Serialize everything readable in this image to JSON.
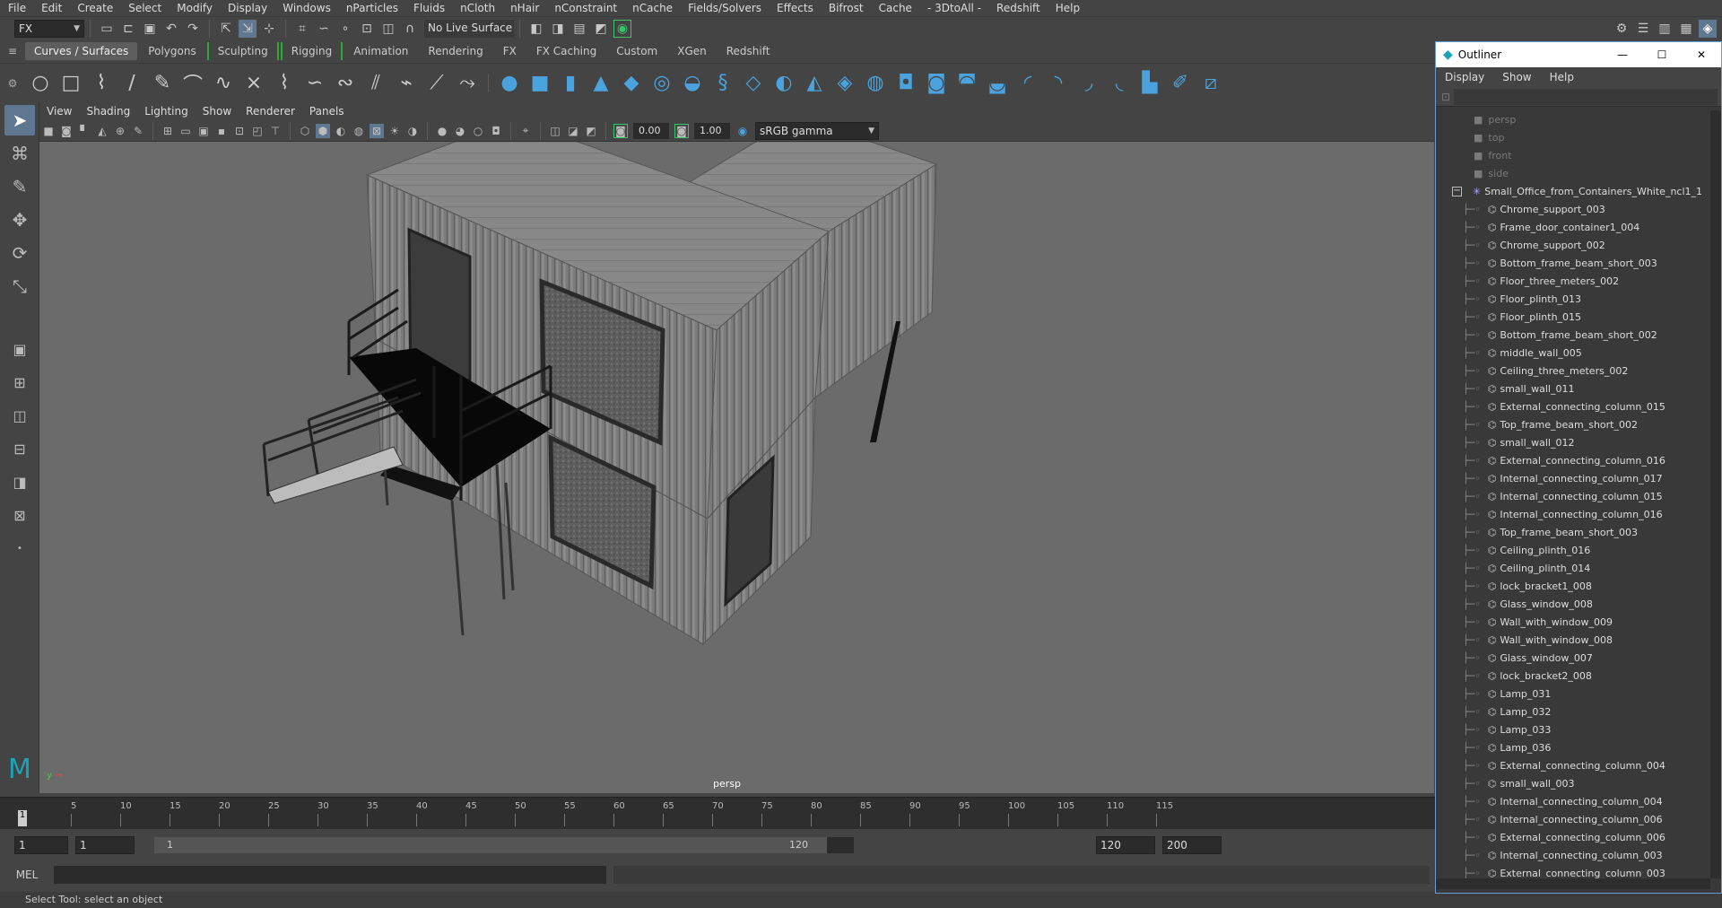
{
  "menu": [
    "File",
    "Edit",
    "Create",
    "Select",
    "Modify",
    "Display",
    "Windows",
    "nParticles",
    "Fluids",
    "nCloth",
    "nHair",
    "nConstraint",
    "nCache",
    "Fields/Solvers",
    "Effects",
    "Bifrost",
    "Cache",
    "- 3DtoAll -",
    "Redshift",
    "Help"
  ],
  "status": {
    "mode_value": "FX",
    "live_surface": "No Live Surface"
  },
  "shelf_tabs": [
    "Curves / Surfaces",
    "Polygons",
    "Sculpting",
    "Rigging",
    "Animation",
    "Rendering",
    "FX",
    "FX Caching",
    "Custom",
    "XGen",
    "Redshift"
  ],
  "panel_menu": [
    "View",
    "Shading",
    "Lighting",
    "Show",
    "Renderer",
    "Panels"
  ],
  "panel_toolbar": {
    "exposure": "0.00",
    "gamma": "1.00",
    "color_space": "sRGB gamma"
  },
  "viewport_label": "persp",
  "timeline": {
    "ticks": [
      "5",
      "10",
      "15",
      "20",
      "25",
      "30",
      "35",
      "40",
      "45",
      "50",
      "55",
      "60",
      "65",
      "70",
      "75",
      "80",
      "85",
      "90",
      "95",
      "100",
      "105",
      "110",
      "115"
    ],
    "current": "1"
  },
  "range": {
    "start": "1",
    "inner_start": "1",
    "slider_start": "1",
    "slider_end": "120",
    "end": "120",
    "max_end": "200"
  },
  "cmd": {
    "label": "MEL"
  },
  "help_line": "Select Tool: select an object",
  "outliner": {
    "title": "Outliner",
    "menu": [
      "Display",
      "Show",
      "Help"
    ],
    "cameras": [
      "persp",
      "top",
      "front",
      "side"
    ],
    "group": "Small_Office_from_Containers_White_ncl1_1",
    "items": [
      "Chrome_support_003",
      "Frame_door_container1_004",
      "Chrome_support_002",
      "Bottom_frame_beam_short_003",
      "Floor_three_meters_002",
      "Floor_plinth_013",
      "Floor_plinth_015",
      "Bottom_frame_beam_short_002",
      "middle_wall_005",
      "Ceiling_three_meters_002",
      "small_wall_011",
      "External_connecting_column_015",
      "Top_frame_beam_short_002",
      "small_wall_012",
      "External_connecting_column_016",
      "Internal_connecting_column_017",
      "Internal_connecting_column_015",
      "Internal_connecting_column_016",
      "Top_frame_beam_short_003",
      "Ceiling_plinth_016",
      "Ceiling_plinth_014",
      "lock_bracket1_008",
      "Glass_window_008",
      "Wall_with_window_009",
      "Wall_with_window_008",
      "Glass_window_007",
      "lock_bracket2_008",
      "Lamp_031",
      "Lamp_032",
      "Lamp_033",
      "Lamp_036",
      "External_connecting_column_004",
      "small_wall_003",
      "Internal_connecting_column_004",
      "Internal_connecting_column_006",
      "External_connecting_column_006",
      "Internal_connecting_column_003",
      "External_connecting_column_003"
    ]
  }
}
